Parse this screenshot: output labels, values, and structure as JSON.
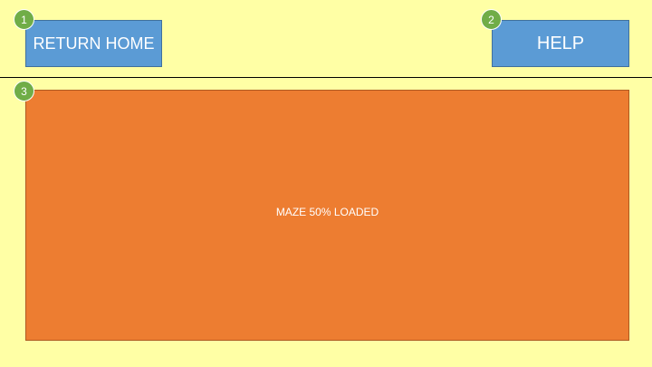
{
  "buttons": {
    "return_home": "RETURN HOME",
    "help": "HELP"
  },
  "maze": {
    "status": "MAZE 50% LOADED",
    "load_percent": 50
  },
  "annotations": {
    "badge_1": "1",
    "badge_2": "2",
    "badge_3": "3"
  },
  "colors": {
    "background": "#FFFFA5",
    "button": "#5B9BD5",
    "maze_panel": "#ED7D31",
    "badge": "#70AD47"
  }
}
